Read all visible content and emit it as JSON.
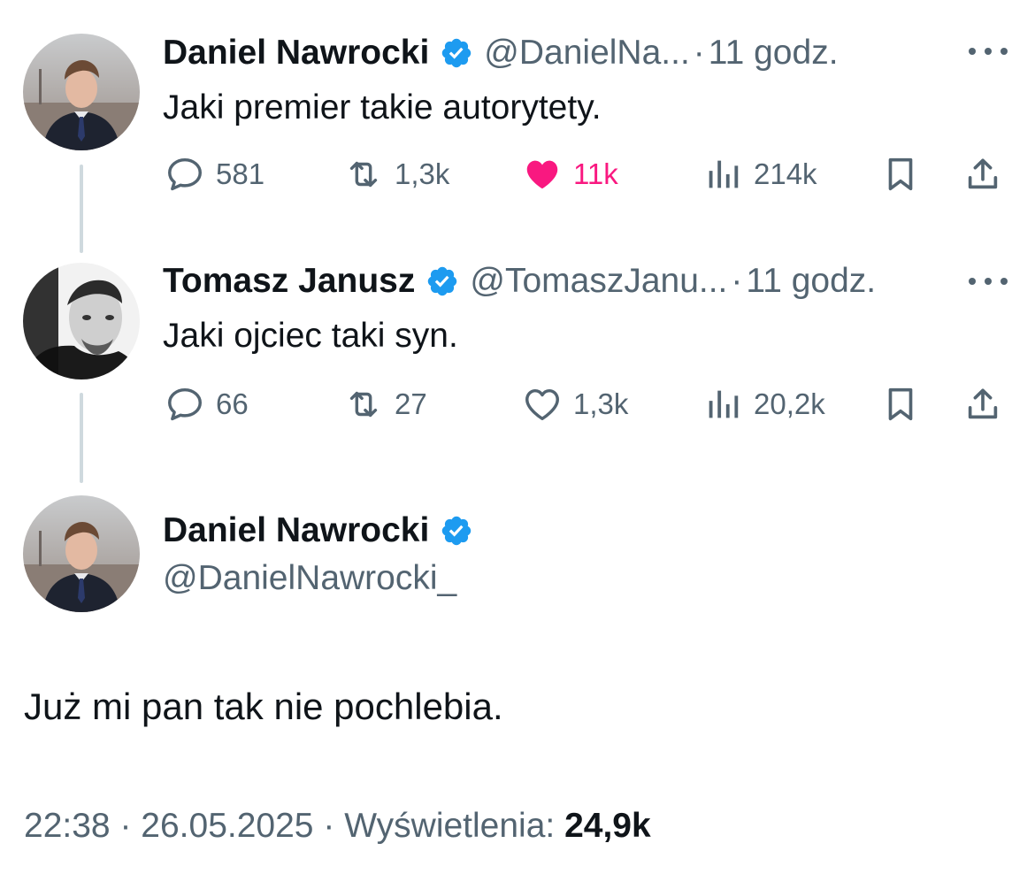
{
  "tweets": [
    {
      "name": "Daniel Nawrocki",
      "handle": "@DanielNa...",
      "time": "11 godz.",
      "text": "Jaki premier takie autorytety.",
      "replies": "581",
      "retweets": "1,3k",
      "likes": "11k",
      "views": "214k",
      "liked": true
    },
    {
      "name": "Tomasz Janusz",
      "handle": "@TomaszJanu...",
      "time": "11 godz.",
      "text": "Jaki ojciec taki syn.",
      "replies": "66",
      "retweets": "27",
      "likes": "1,3k",
      "views": "20,2k",
      "liked": false
    }
  ],
  "main_tweet": {
    "name": "Daniel Nawrocki",
    "handle": "@DanielNawrocki_",
    "text": "Już mi pan tak nie pochlebia.",
    "time": "22:38",
    "date": "26.05.2025",
    "views_label": "Wyświetlenia:",
    "views": "24,9k"
  },
  "separator": "·",
  "icons": {
    "verified": "verified-badge-icon",
    "reply": "reply-icon",
    "retweet": "retweet-icon",
    "like": "heart-icon",
    "views": "views-icon",
    "bookmark": "bookmark-icon",
    "share": "share-icon",
    "more": "more-icon"
  },
  "colors": {
    "verified": "#1d9bf0",
    "liked": "#f91880",
    "secondary_text": "#536471",
    "thread_line": "#cfd9de"
  }
}
